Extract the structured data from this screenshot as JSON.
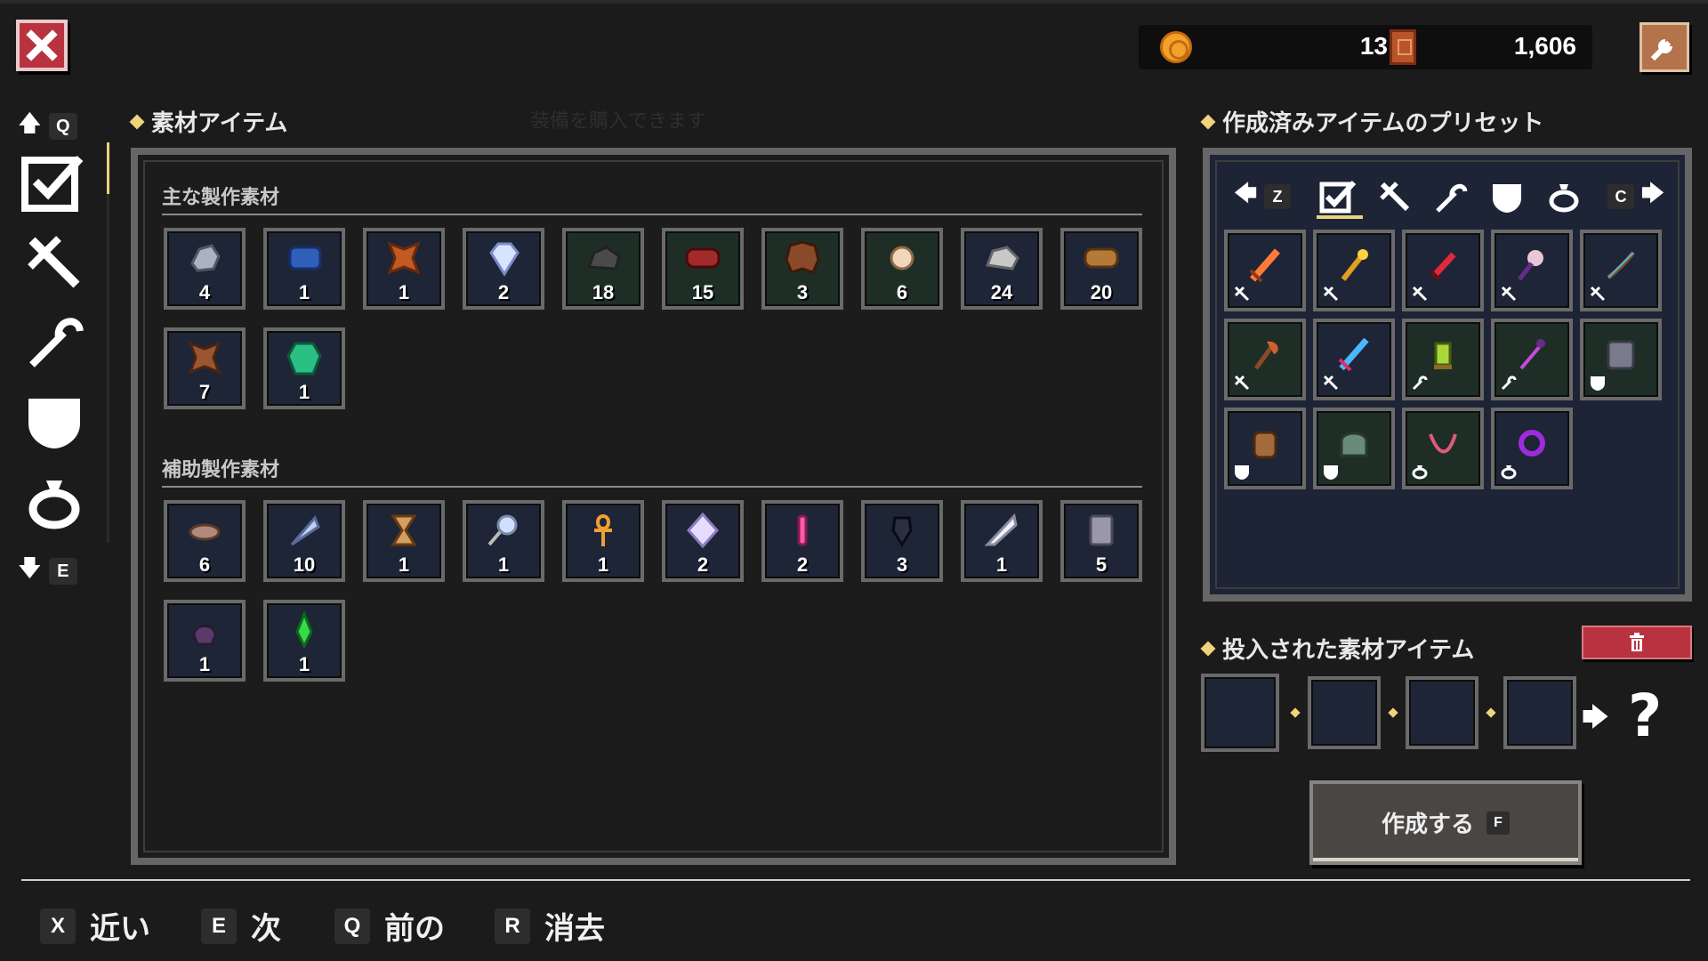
{
  "currency": {
    "coins": "13",
    "tomes": "1,606",
    "coin_icon": "coin-icon",
    "tome_icon": "book-icon"
  },
  "nav": {
    "up_key": "Q",
    "down_key": "E",
    "categories": [
      "check-icon",
      "sword-icon",
      "staff-icon",
      "shield-icon",
      "ring-icon"
    ],
    "active": "check-icon"
  },
  "materials": {
    "title": "素材アイテム",
    "ghost_text": "装備を購入できます",
    "main_title": "主な製作素材",
    "main_items": [
      {
        "icon": "ore-icon",
        "qty": "4",
        "green": false
      },
      {
        "icon": "blue-cloth-icon",
        "qty": "1",
        "green": false
      },
      {
        "icon": "leather-icon",
        "qty": "1",
        "green": false
      },
      {
        "icon": "diamond-icon",
        "qty": "2",
        "green": false
      },
      {
        "icon": "coal-icon",
        "qty": "18",
        "green": true
      },
      {
        "icon": "red-log-icon",
        "qty": "15",
        "green": true
      },
      {
        "icon": "hide-icon",
        "qty": "3",
        "green": true
      },
      {
        "icon": "pearl-icon",
        "qty": "6",
        "green": true
      },
      {
        "icon": "stone-icon",
        "qty": "24",
        "green": false
      },
      {
        "icon": "wood-log-icon",
        "qty": "20",
        "green": false
      },
      {
        "icon": "pelt-icon",
        "qty": "7",
        "green": false
      },
      {
        "icon": "emerald-icon",
        "qty": "1",
        "green": false
      }
    ],
    "aux_title": "補助製作素材",
    "aux_items": [
      {
        "icon": "feather-brown-icon",
        "qty": "6"
      },
      {
        "icon": "blue-feather-icon",
        "qty": "10"
      },
      {
        "icon": "hourglass-icon",
        "qty": "1"
      },
      {
        "icon": "magnifier-icon",
        "qty": "1"
      },
      {
        "icon": "ankh-icon",
        "qty": "1"
      },
      {
        "icon": "crystal-icon",
        "qty": "2"
      },
      {
        "icon": "pink-crystal-icon",
        "qty": "2"
      },
      {
        "icon": "dark-gem-icon",
        "qty": "3"
      },
      {
        "icon": "white-feather-icon",
        "qty": "1"
      },
      {
        "icon": "scroll-icon",
        "qty": "5"
      },
      {
        "icon": "pot-icon",
        "qty": "1"
      },
      {
        "icon": "green-crystal-icon",
        "qty": "1"
      }
    ]
  },
  "presets": {
    "title": "作成済みアイテムのプリセット",
    "left_key": "Z",
    "right_key": "C",
    "tabs": [
      "check-icon",
      "sword-icon",
      "staff-icon",
      "shield-icon",
      "ring-icon"
    ],
    "items": [
      {
        "icon": "flame-sword-icon",
        "badge": "sword-badge",
        "green": false
      },
      {
        "icon": "golden-staff-icon",
        "badge": "sword-badge",
        "green": false
      },
      {
        "icon": "crimson-dagger-icon",
        "badge": "sword-badge",
        "green": false
      },
      {
        "icon": "orb-mace-icon",
        "badge": "sword-badge",
        "green": false
      },
      {
        "icon": "bow-icon",
        "badge": "sword-badge",
        "green": false
      },
      {
        "icon": "axe-icon",
        "badge": "sword-badge",
        "green": true
      },
      {
        "icon": "ice-sword-icon",
        "badge": "sword-badge",
        "green": false
      },
      {
        "icon": "lantern-icon",
        "badge": "staff-badge",
        "green": true
      },
      {
        "icon": "wand-icon",
        "badge": "staff-badge",
        "green": true
      },
      {
        "icon": "chainmail-icon",
        "badge": "shield-badge",
        "green": true
      },
      {
        "icon": "gauntlet-icon",
        "badge": "shield-badge",
        "green": false
      },
      {
        "icon": "helmet-icon",
        "badge": "shield-badge",
        "green": true
      },
      {
        "icon": "necklace-icon",
        "badge": "ring-badge",
        "green": true
      },
      {
        "icon": "dark-ring-icon",
        "badge": "ring-badge",
        "green": false
      }
    ]
  },
  "input": {
    "title": "投入された素材アイテム",
    "result": "?"
  },
  "craft": {
    "label": "作成する",
    "key": "F"
  },
  "footer": [
    {
      "key": "X",
      "label": "近い"
    },
    {
      "key": "E",
      "label": "次"
    },
    {
      "key": "Q",
      "label": "前の"
    },
    {
      "key": "R",
      "label": "消去"
    }
  ],
  "colors": {
    "accent": "#e8d27d",
    "close": "#b8333f",
    "panel_border": "#666666"
  }
}
